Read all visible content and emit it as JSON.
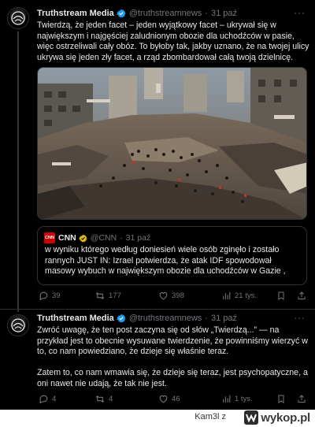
{
  "tweets": [
    {
      "name": "Truthstream Media",
      "handle": "@truthstreamnews",
      "time": "31 paź",
      "more": "···",
      "text": "Twierdzą, że jeden facet – jeden wyjątkowy facet – ukrywał się w największym i najgęściej zaludnionym obozie dla uchodźców w pasie, więc ostrzeliwali cały obóz.  To byłoby tak, jakby uznano, że na twojej ulicy ukrywa się jeden zły facet, a rząd zbombardował całą twoją dzielnicę.",
      "quote": {
        "logo": "CNN",
        "name": "CNN",
        "handle": "@CNN",
        "time": "31 paź",
        "text": " w wyniku którego według doniesień wiele osób zginęło i zostało rannych JUST IN: Izrael potwierdza, że atak IDF spowodował masowy wybuch w największym obozie dla uchodźców w Gazie ,"
      },
      "stats": {
        "replies": "39",
        "reposts": "177",
        "likes": "398",
        "views": "21 tys."
      }
    },
    {
      "name": "Truthstream Media",
      "handle": "@truthstreamnews",
      "time": "31 paź",
      "more": "···",
      "text": "Zwróć uwagę, że ten post zaczyna się od słów „Twierdzą...” — na przykład jest to obecnie wysuwane twierdzenie, że powinniśmy wierzyć w to, co nam powiedziano, że dzieje się właśnie teraz.\n\n Zatem to, co nam wmawia się, że dzieje się teraz, jest psychopatyczne, a oni nawet nie udają, że tak nie jest.",
      "stats": {
        "replies": "4",
        "reposts": "4",
        "likes": "46",
        "views": "1 tys."
      }
    }
  ],
  "footer": {
    "author": "Kam3l",
    "separator": "z",
    "site": "wykop.pl"
  },
  "colors": {
    "background": "#000000",
    "text": "#e7e9ea",
    "muted": "#71767b",
    "verified": "#1d9bf0",
    "cnn": "#cc0000"
  }
}
